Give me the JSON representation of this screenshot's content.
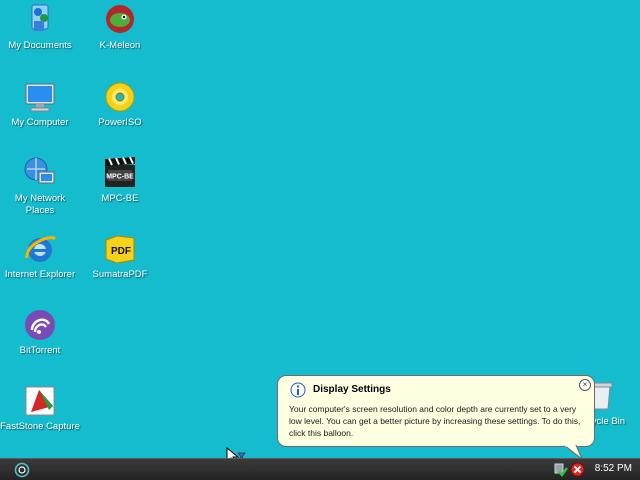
{
  "desktop": {
    "icons": [
      {
        "label": "My Documents",
        "icon": "my-documents-icon"
      },
      {
        "label": "K-Meleon",
        "icon": "k-meleon-icon"
      },
      {
        "label": "My Computer",
        "icon": "my-computer-icon"
      },
      {
        "label": "PowerISO",
        "icon": "poweriso-icon"
      },
      {
        "label": "My Network Places",
        "icon": "network-places-icon"
      },
      {
        "label": "MPC-BE",
        "icon": "mpc-be-icon"
      },
      {
        "label": "Internet Explorer",
        "icon": "internet-explorer-icon"
      },
      {
        "label": "SumatraPDF",
        "icon": "sumatrapdf-icon"
      },
      {
        "label": "BitTorrent",
        "icon": "bittorrent-icon"
      },
      {
        "label": "FastStone Capture",
        "icon": "faststone-capture-icon"
      },
      {
        "label": "Recycle Bin",
        "icon": "recycle-bin-icon"
      }
    ]
  },
  "balloon": {
    "title": "Display Settings",
    "text": "Your computer's screen resolution and color depth are currently set to a very low level. You can get a better picture by increasing these settings. To do this, click this balloon.",
    "close_glyph": "×"
  },
  "taskbar": {
    "clock": "8:52 PM"
  },
  "colors": {
    "desktop": "#14bccd",
    "taskbar": "#2a2a2a",
    "balloon": "#ffffe1"
  }
}
